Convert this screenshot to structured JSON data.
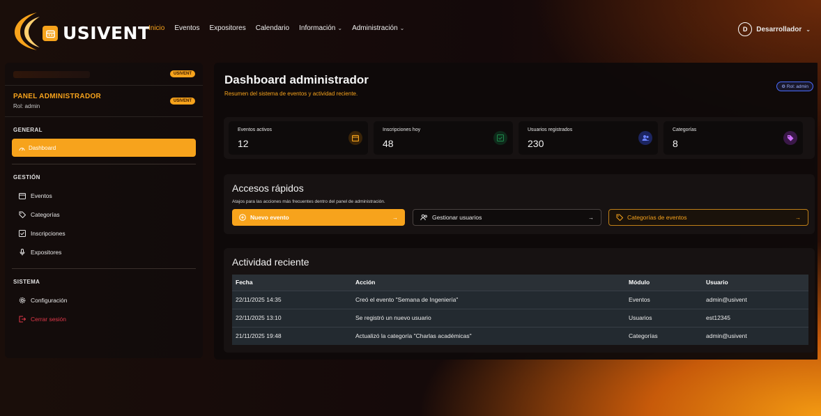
{
  "brand": {
    "name": "USIVENT",
    "accent": "#f7a31c"
  },
  "nav": {
    "links": [
      {
        "label": "Inicio",
        "active": true
      },
      {
        "label": "Eventos"
      },
      {
        "label": "Expositores"
      },
      {
        "label": "Calendario"
      },
      {
        "label": "Información",
        "dropdown": true
      },
      {
        "label": "Administración",
        "dropdown": true
      }
    ],
    "user": {
      "initial": "D",
      "name": "Desarrollador"
    }
  },
  "sidebar": {
    "top_badge": "USIVENT",
    "panel_title": "PANEL ADMINISTRADOR",
    "panel_role": "Rol: admin",
    "panel_badge": "USIVENT",
    "sections": [
      {
        "title": "GENERAL",
        "items": [
          {
            "label": "Dashboard",
            "icon": "dashboard-icon",
            "active": true
          }
        ]
      },
      {
        "title": "GESTIÓN",
        "items": [
          {
            "label": "Eventos",
            "icon": "calendar-icon"
          },
          {
            "label": "Categorías",
            "icon": "tag-icon"
          },
          {
            "label": "Inscripciones",
            "icon": "checklist-icon"
          },
          {
            "label": "Expositores",
            "icon": "microphone-icon"
          }
        ]
      },
      {
        "title": "SISTEMA",
        "items": [
          {
            "label": "Configuración",
            "icon": "gear-icon"
          },
          {
            "label": "Cerrar sesión",
            "icon": "logout-icon",
            "danger": true
          }
        ]
      }
    ]
  },
  "main": {
    "title": "Dashboard administrador",
    "subtitle": "Resumen del sistema de eventos y actividad reciente.",
    "role_badge": "Rol: admin",
    "stats": [
      {
        "label": "Eventos activos",
        "value": "12",
        "icon": "calendar-icon",
        "color": "#f7a31c"
      },
      {
        "label": "Inscripciones hoy",
        "value": "48",
        "icon": "checklist-icon",
        "color": "#1f8a4c"
      },
      {
        "label": "Usuarios registrados",
        "value": "230",
        "icon": "users-icon",
        "color": "#3a56e0"
      },
      {
        "label": "Categorías",
        "value": "8",
        "icon": "tag-icon",
        "color": "#b04ad8"
      }
    ],
    "quick": {
      "title": "Accesos rápidos",
      "subtitle": "Atajos para las acciones más frecuentes dentro del panel de administración.",
      "buttons": [
        {
          "label": "Nuevo evento",
          "icon": "plus-circle-icon",
          "arrow": "→"
        },
        {
          "label": "Gestionar usuarios",
          "icon": "users-icon",
          "arrow": "→"
        },
        {
          "label": "Categorías de eventos",
          "icon": "tag-icon",
          "arrow": "→"
        }
      ]
    },
    "activity": {
      "title": "Actividad reciente",
      "columns": [
        "Fecha",
        "Acción",
        "Módulo",
        "Usuario"
      ],
      "rows": [
        [
          "22/11/2025 14:35",
          "Creó el evento \"Semana de Ingeniería\"",
          "Eventos",
          "admin@usivent"
        ],
        [
          "22/11/2025 13:10",
          "Se registró un nuevo usuario",
          "Usuarios",
          "est12345"
        ],
        [
          "21/11/2025 19:48",
          "Actualizó la categoría \"Charlas académicas\"",
          "Categorías",
          "admin@usivent"
        ]
      ]
    }
  }
}
